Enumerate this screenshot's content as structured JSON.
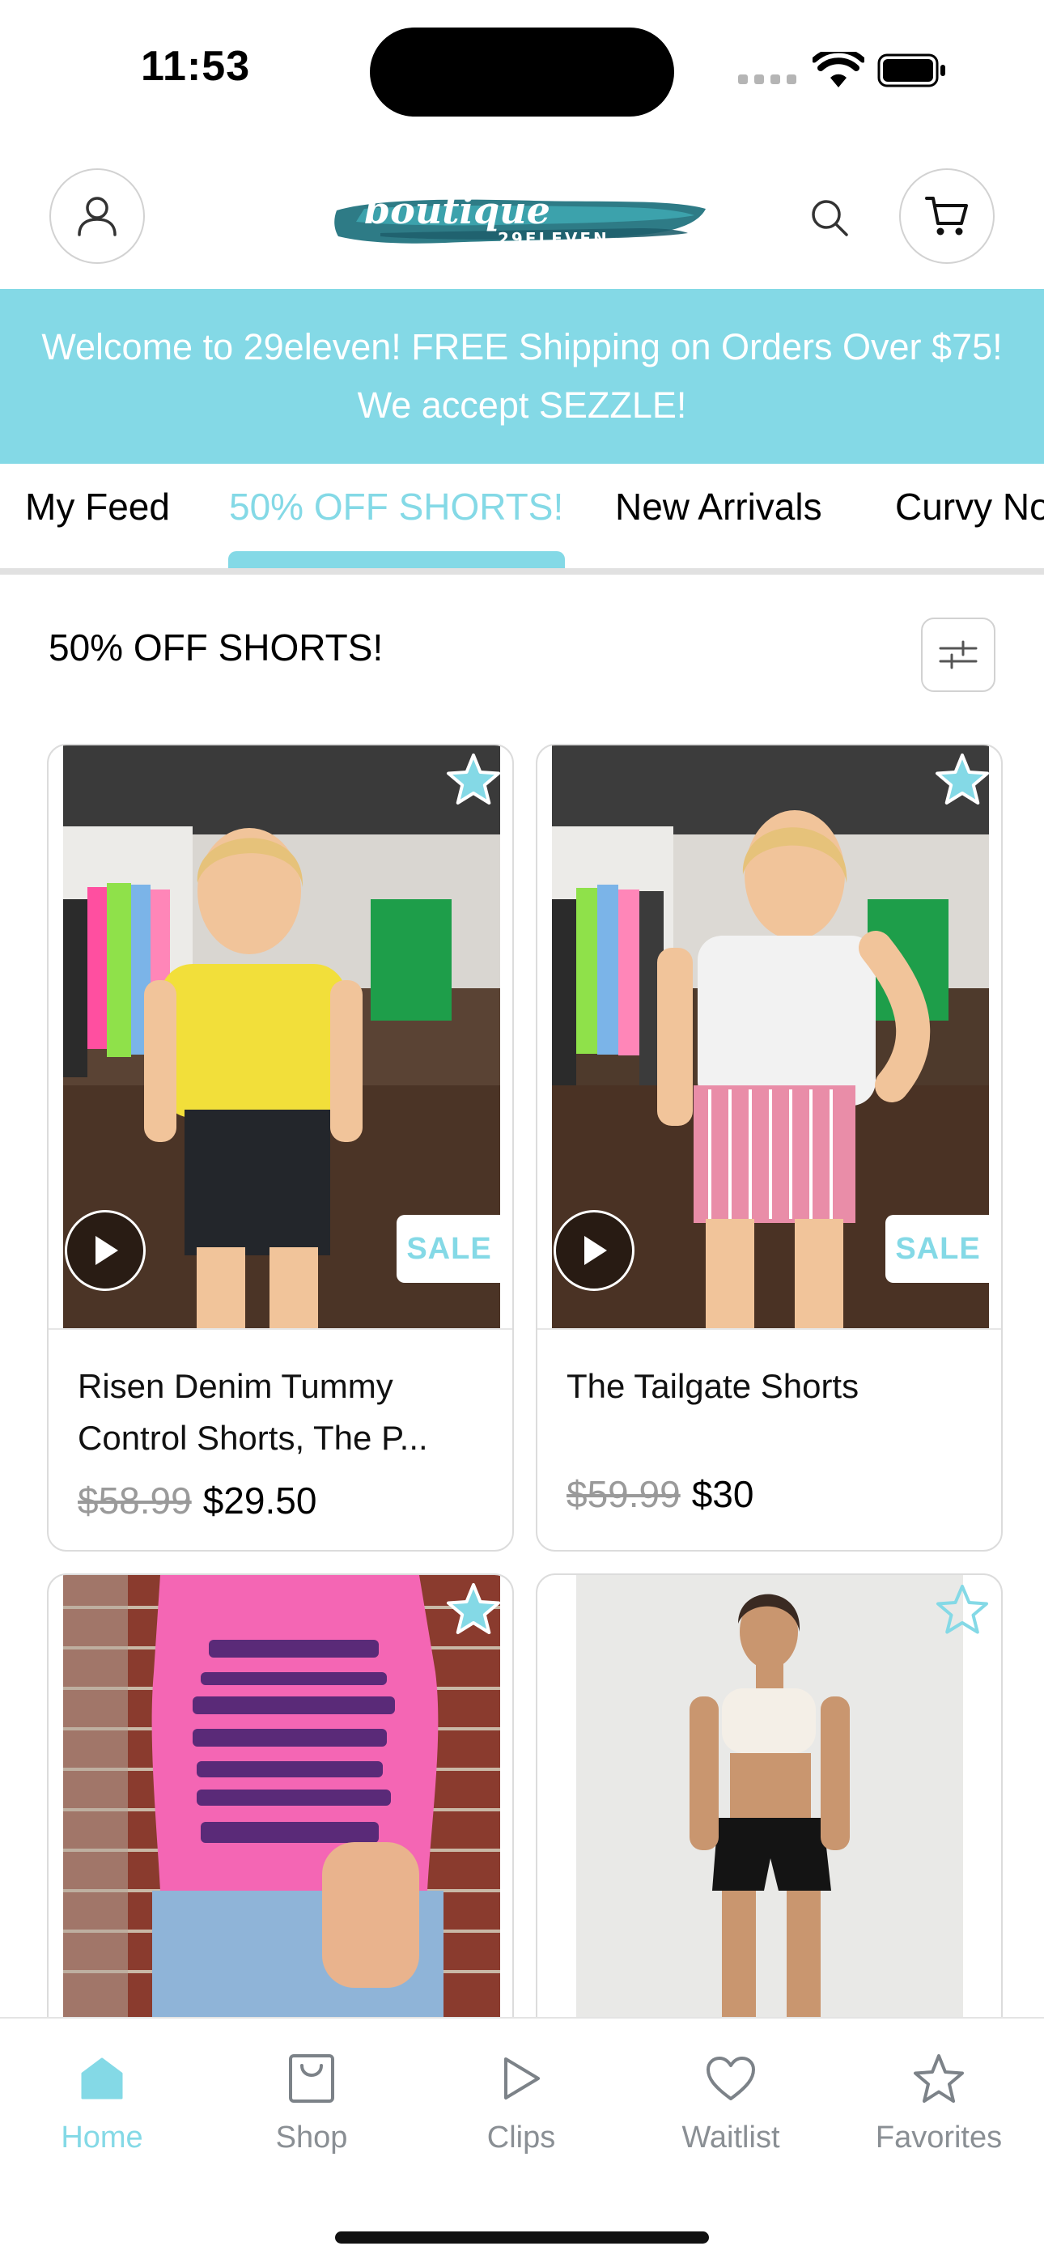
{
  "status_bar": {
    "time": "11:53"
  },
  "header": {
    "logo": {
      "main": "boutique",
      "sub": "29ELEVEN"
    },
    "icons": [
      "person-icon",
      "search-icon",
      "cart-icon"
    ]
  },
  "banner": {
    "text": "Welcome to 29eleven! FREE Shipping on Orders Over $75! We accept SEZZLE!"
  },
  "tabs": [
    {
      "label": "My Feed",
      "active": false
    },
    {
      "label": "50% OFF SHORTS!",
      "active": true
    },
    {
      "label": "New Arrivals",
      "active": false
    },
    {
      "label": "Curvy No",
      "active": false
    }
  ],
  "section": {
    "title": "50% OFF SHORTS!"
  },
  "products": [
    {
      "name": "Risen Denim Tummy Control Shorts, The P...",
      "old_price": "$58.99",
      "price": "$29.50",
      "badge": "SALE",
      "has_video": true,
      "favorite": false
    },
    {
      "name": "The Tailgate Shorts",
      "old_price": "$59.99",
      "price": "$30",
      "badge": "SALE",
      "has_video": true,
      "favorite": false
    },
    {
      "name": "",
      "favorite": false
    },
    {
      "name": "",
      "favorite": false
    }
  ],
  "bottom_nav": [
    {
      "label": "Home",
      "icon": "home-icon",
      "active": true
    },
    {
      "label": "Shop",
      "icon": "shopping-bag-icon",
      "active": false
    },
    {
      "label": "Clips",
      "icon": "play-icon",
      "active": false
    },
    {
      "label": "Waitlist",
      "icon": "heart-icon",
      "active": false
    },
    {
      "label": "Favorites",
      "icon": "star-icon",
      "active": false
    }
  ],
  "colors": {
    "accent": "#84d9e6",
    "text": "#111111",
    "muted": "#8a8f94",
    "border": "#dcdcdc"
  }
}
